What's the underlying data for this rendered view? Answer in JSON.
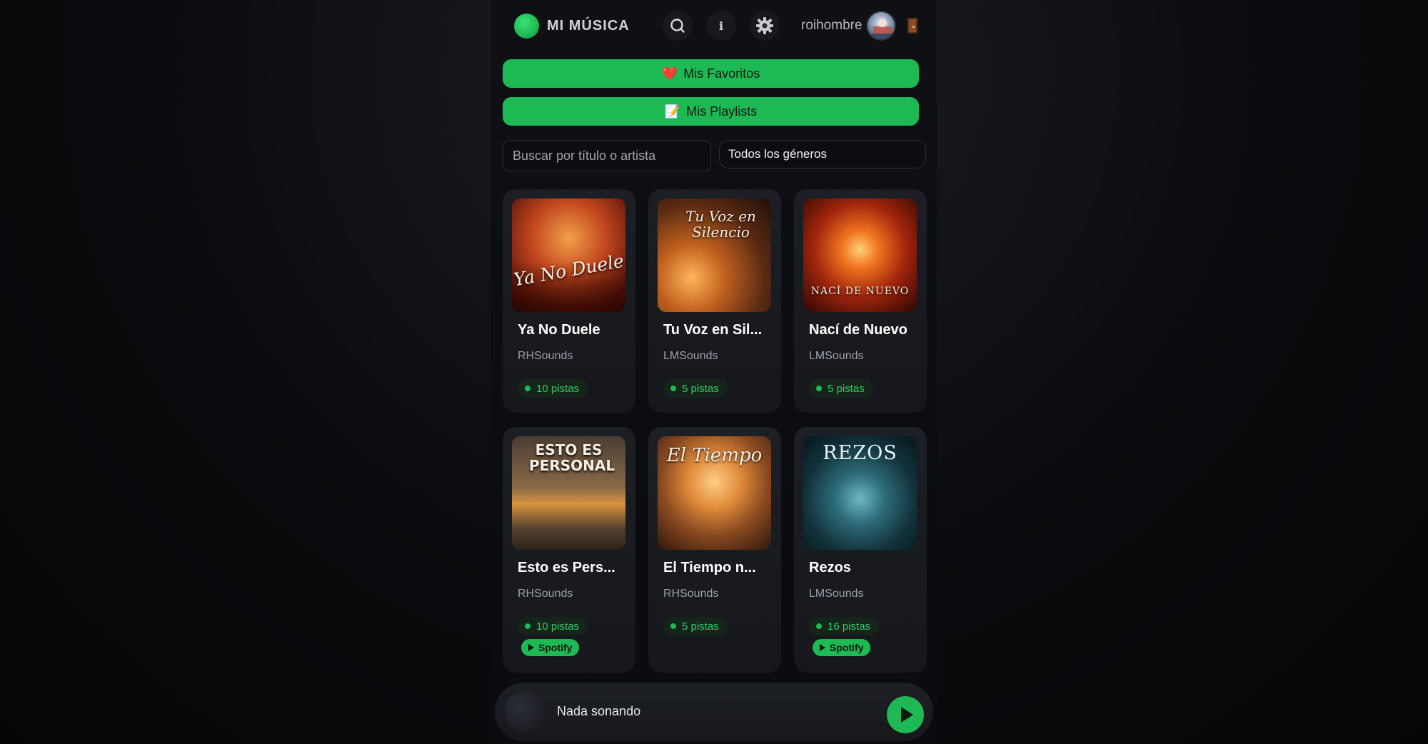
{
  "header": {
    "title": "MI MÚSICA",
    "username": "roihombre",
    "icons": [
      "search-icon",
      "info-icon",
      "gear-icon",
      "avatar",
      "logout-door-icon"
    ]
  },
  "info_label": "i",
  "favorites_button": {
    "emoji": "❤️",
    "label": "Mis Favoritos"
  },
  "playlists_button": {
    "emoji": "📝",
    "label": "Mis Playlists"
  },
  "search": {
    "placeholder": "Buscar por título o artista",
    "value": ""
  },
  "genre_select": {
    "selected": "Todos los géneros"
  },
  "colors": {
    "accent": "#1db954",
    "background": "#0b0c0f",
    "card": "#1c1f25"
  },
  "albums": [
    {
      "title": "Ya No Duele",
      "artist": "RHSounds",
      "tracks": "10 pistas",
      "spotify": "",
      "cover_text": "Ya No Duele"
    },
    {
      "title": "Tu Voz en Sil...",
      "artist": "LMSounds",
      "tracks": "5 pistas",
      "spotify": "",
      "cover_text": "Tu Voz en Silencio"
    },
    {
      "title": "Nací de Nuevo",
      "artist": "LMSounds",
      "tracks": "5 pistas",
      "spotify": "",
      "cover_text": "NACÍ DE NUEVO"
    },
    {
      "title": "Esto es Pers...",
      "artist": "RHSounds",
      "tracks": "10 pistas",
      "spotify": "Spotify",
      "cover_text": "ESTO ES PERSONAL"
    },
    {
      "title": "El Tiempo n...",
      "artist": "RHSounds",
      "tracks": "5 pistas",
      "spotify": "",
      "cover_text": "El Tiempo"
    },
    {
      "title": "Rezos",
      "artist": "LMSounds",
      "tracks": "16 pistas",
      "spotify": "Spotify",
      "cover_text": "REZOS"
    }
  ],
  "player": {
    "status": "Nada sonando"
  }
}
